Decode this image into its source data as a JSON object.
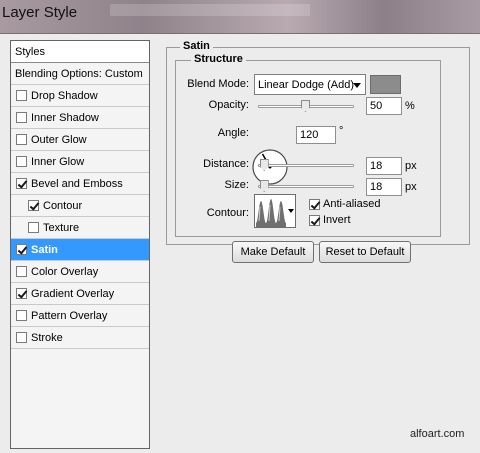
{
  "window": {
    "title": "Layer Style"
  },
  "styles_list": {
    "header": "Styles",
    "items": [
      {
        "label": "Blending Options: Custom",
        "checkbox": false,
        "checked": false,
        "indent": false,
        "selected": false
      },
      {
        "label": "Drop Shadow",
        "checkbox": true,
        "checked": false,
        "indent": false,
        "selected": false
      },
      {
        "label": "Inner Shadow",
        "checkbox": true,
        "checked": false,
        "indent": false,
        "selected": false
      },
      {
        "label": "Outer Glow",
        "checkbox": true,
        "checked": false,
        "indent": false,
        "selected": false
      },
      {
        "label": "Inner Glow",
        "checkbox": true,
        "checked": false,
        "indent": false,
        "selected": false
      },
      {
        "label": "Bevel and Emboss",
        "checkbox": true,
        "checked": true,
        "indent": false,
        "selected": false
      },
      {
        "label": "Contour",
        "checkbox": true,
        "checked": true,
        "indent": true,
        "selected": false
      },
      {
        "label": "Texture",
        "checkbox": true,
        "checked": false,
        "indent": true,
        "selected": false
      },
      {
        "label": "Satin",
        "checkbox": true,
        "checked": true,
        "indent": false,
        "selected": true
      },
      {
        "label": "Color Overlay",
        "checkbox": true,
        "checked": false,
        "indent": false,
        "selected": false
      },
      {
        "label": "Gradient Overlay",
        "checkbox": true,
        "checked": true,
        "indent": false,
        "selected": false
      },
      {
        "label": "Pattern Overlay",
        "checkbox": true,
        "checked": false,
        "indent": false,
        "selected": false
      },
      {
        "label": "Stroke",
        "checkbox": true,
        "checked": false,
        "indent": false,
        "selected": false
      }
    ]
  },
  "satin": {
    "group_label": "Satin",
    "structure_label": "Structure",
    "blend_mode": {
      "label": "Blend Mode:",
      "value": "Linear Dodge (Add)",
      "color": "#8c8c8c"
    },
    "opacity": {
      "label": "Opacity:",
      "value": "50",
      "unit": "%",
      "level": 0.5
    },
    "angle": {
      "label": "Angle:",
      "value": "120",
      "unit": "°",
      "degrees": 120
    },
    "distance": {
      "label": "Distance:",
      "value": "18",
      "unit": "px",
      "level": 0.07
    },
    "size": {
      "label": "Size:",
      "value": "18",
      "unit": "px",
      "level": 0.07
    },
    "contour": {
      "label": "Contour:"
    },
    "anti_aliased": {
      "label": "Anti-aliased",
      "checked": true
    },
    "invert": {
      "label": "Invert",
      "checked": true
    }
  },
  "buttons": {
    "make_default": "Make Default",
    "reset_default": "Reset to Default"
  },
  "watermark": "alfoart.com",
  "colors": {
    "selection": "#3399ff"
  }
}
